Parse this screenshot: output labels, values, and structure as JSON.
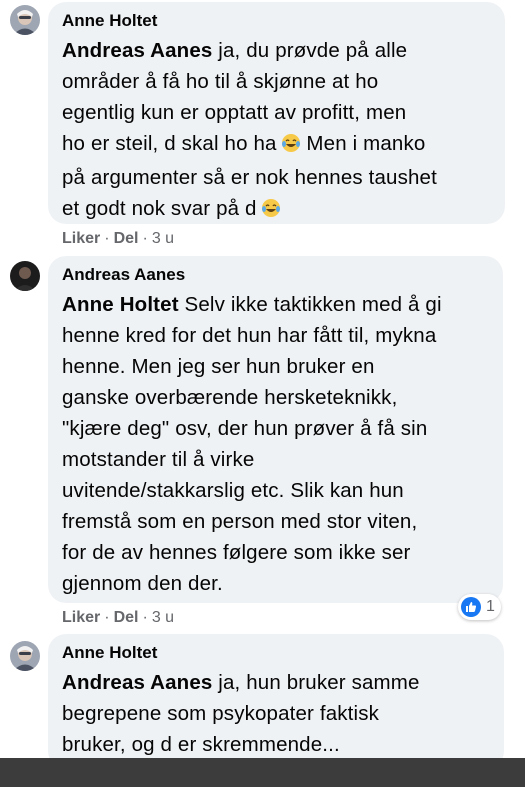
{
  "comments": [
    {
      "author": "Anne Holtet",
      "mention": "Andreas Aanes",
      "lines": [
        " ja, du prøvde på alle",
        "områder å få ho til å skjønne at ho",
        "egentlig kun er opptatt av profitt, men",
        "ho er steil, d skal ho ha",
        "på argumenter så er nok hennes taushet",
        "et godt nok svar på d"
      ],
      "line4_after_emoji": " Men i manko",
      "emoji": "laughing-crying-face",
      "like_label": "Liker",
      "share_label": "Del",
      "time": "3 u"
    },
    {
      "author": "Andreas Aanes",
      "mention": "Anne Holtet",
      "lines": [
        " Selv ikke taktikken med å gi",
        "henne kred for det hun har fått til, mykna",
        "henne. Men jeg ser hun bruker en",
        "ganske overbærende hersketeknikk,",
        "\"kjære deg\" osv, der hun prøver å få sin",
        "motstander til å virke",
        "uvitende/stakkarslig etc. Slik kan hun",
        "fremstå som en person med stor viten,",
        "for de av hennes følgere som ikke ser",
        "gjennom den der."
      ],
      "like_label": "Liker",
      "share_label": "Del",
      "time": "3 u",
      "reaction_count": "1",
      "reaction_icon": "thumbs-up-icon"
    },
    {
      "author": "Anne Holtet",
      "mention": "Andreas Aanes",
      "lines": [
        " ja, hun bruker samme",
        "begrepene som psykopater faktisk",
        "bruker, og d er skremmende..."
      ]
    }
  ],
  "colors": {
    "bubble": "#eff2f5",
    "meta_text": "#65676b",
    "like_blue": "#1877f2",
    "bottom_bar": "#3c3c3c"
  }
}
